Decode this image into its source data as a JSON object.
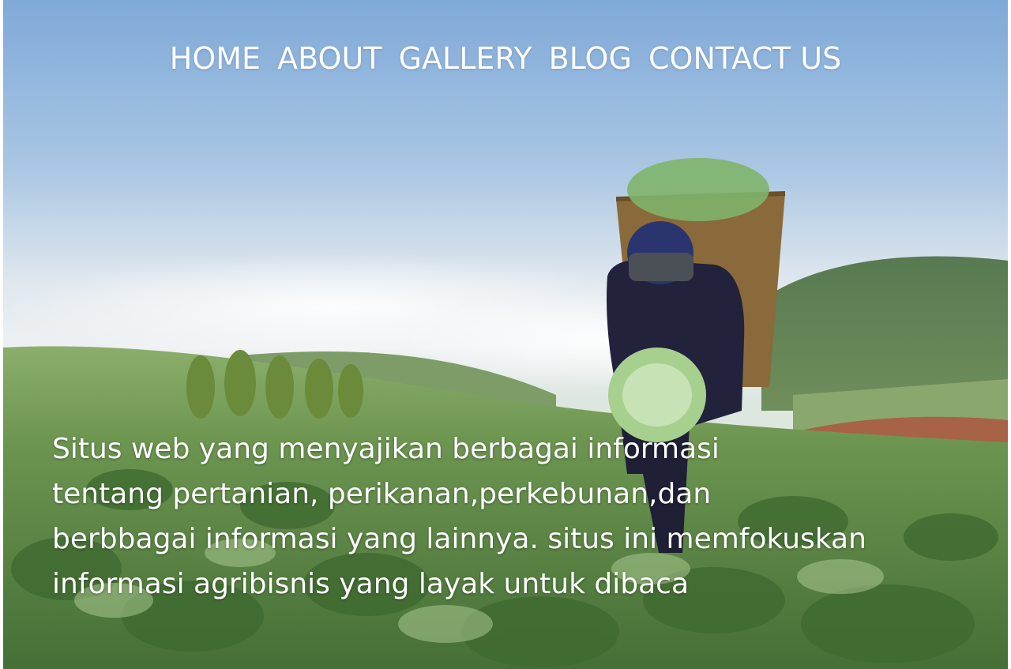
{
  "nav": {
    "items": [
      {
        "label": "HOME"
      },
      {
        "label": "ABOUT"
      },
      {
        "label": "GALLERY"
      },
      {
        "label": "BLOG"
      },
      {
        "label": "CONTACT US"
      }
    ]
  },
  "hero": {
    "lines": [
      "Situs web yang menyajikan berbagai informasi",
      "tentang pertanian, perikanan,perkebunan,dan",
      "berbbagai informasi yang lainnya. situs ini memfokuskan",
      "informasi agribisnis yang layak untuk dibaca"
    ],
    "image": "farmer-carrying-cabbage-basket-in-field"
  },
  "colors": {
    "nav_text": "#ffffff",
    "text": "#ffffff",
    "sky_top": "#86b0dc",
    "field": "#5e8a45"
  }
}
